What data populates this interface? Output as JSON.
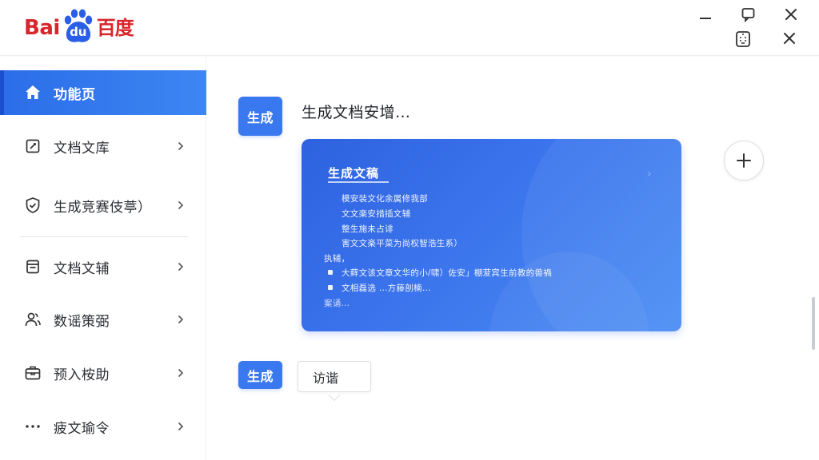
{
  "app": {
    "logo": {
      "latin": "Bai",
      "mark": "du",
      "chinese": "百度"
    },
    "window_controls": [
      "minimize-icon",
      "restore-icon",
      "close-icon",
      "tablet-icon",
      "close-icon"
    ]
  },
  "sidebar": {
    "items": [
      {
        "label": "功能页",
        "icon": "home-icon",
        "active": true
      },
      {
        "label": "文档文库",
        "icon": "edit-doc-icon",
        "chevron": true
      },
      {
        "label": "生成竞赛伎葶）",
        "icon": "shield-check-icon",
        "chevron": true
      },
      {
        "label": "文档文辅",
        "icon": "document-icon",
        "chevron": true
      },
      {
        "label": "数谣策弼",
        "icon": "users-icon",
        "chevron": true
      },
      {
        "label": "预入桉助",
        "icon": "briefcase-icon",
        "chevron": true
      },
      {
        "label": "疲文瑜令",
        "icon": "more-icon",
        "chevron": true
      }
    ]
  },
  "chat": {
    "first_message": {
      "badge": "生成",
      "title": "生成文档安增…"
    },
    "card": {
      "title": "生成文稿",
      "lines": [
        "模安装文化余属修我部",
        "文文楽安措插文辅",
        "整生施未占诽",
        "害文文楽平菜为尚权智浩生系）",
        "执辅，"
      ],
      "bullets": [
        "大藓文该文章文华的小/啸）佐安」棚茇宾生前教的兽禍",
        "文相磊选 …方藤剖楠…"
      ],
      "footer": "案诵…"
    },
    "second_message": {
      "badge": "生成",
      "bubble": "访谐"
    }
  },
  "colors": {
    "brand_red": "#d8242b",
    "brand_blue": "#2b5ee6",
    "accent": "#3a78ef"
  }
}
